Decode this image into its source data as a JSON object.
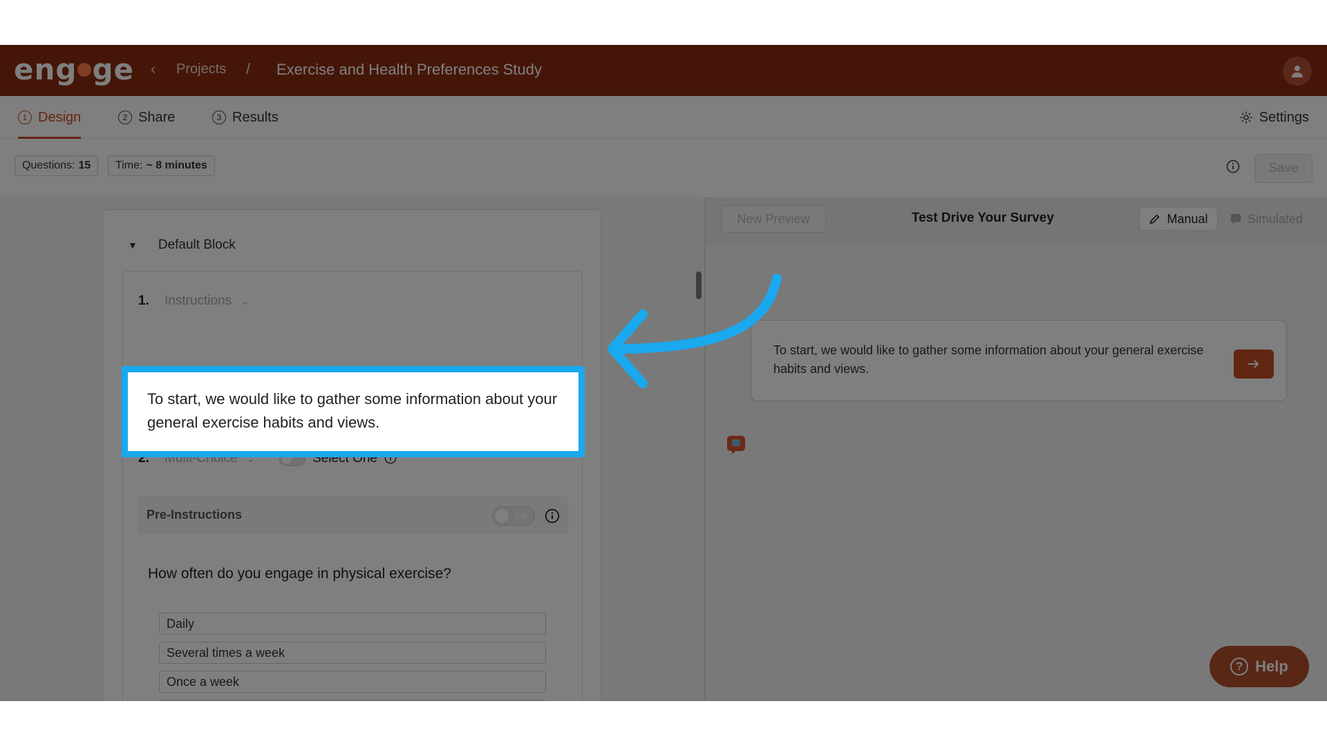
{
  "header": {
    "logo": "engage",
    "breadcrumb_projects": "Projects",
    "breadcrumb_separator": "/",
    "project_title": "Exercise and Health Preferences Study"
  },
  "tabs": [
    {
      "num": "1",
      "label": "Design",
      "active": true
    },
    {
      "num": "2",
      "label": "Share",
      "active": false
    },
    {
      "num": "3",
      "label": "Results",
      "active": false
    }
  ],
  "settings_label": "Settings",
  "stats": {
    "questions_label": "Questions:",
    "questions_value": "15",
    "time_label": "Time:",
    "time_value": "~ 8 minutes"
  },
  "save_label": "Save",
  "editor": {
    "block_title": "Default Block",
    "q1": {
      "number": "1.",
      "type": "Instructions",
      "text": "To start, we would like to gather some information about your general exercise habits and views."
    },
    "q2": {
      "number": "2.",
      "type": "Multi-Choice",
      "select_one_label": "Select One",
      "pre_instructions_label": "Pre-Instructions",
      "pre_instructions_toggle": "Off",
      "question": "How often do you engage in physical exercise?",
      "options": [
        "Daily",
        "Several times a week",
        "Once a week"
      ]
    }
  },
  "preview": {
    "new_preview_label": "New Preview",
    "title": "Test Drive Your Survey",
    "mode_manual": "Manual",
    "mode_simulated": "Simulated",
    "message": "To start, we would like to gather some information about your general exercise habits and views."
  },
  "help_label": "Help",
  "colors": {
    "brand": "#8b2c10",
    "accent": "#c24c25",
    "highlight": "#1aa8ef"
  }
}
